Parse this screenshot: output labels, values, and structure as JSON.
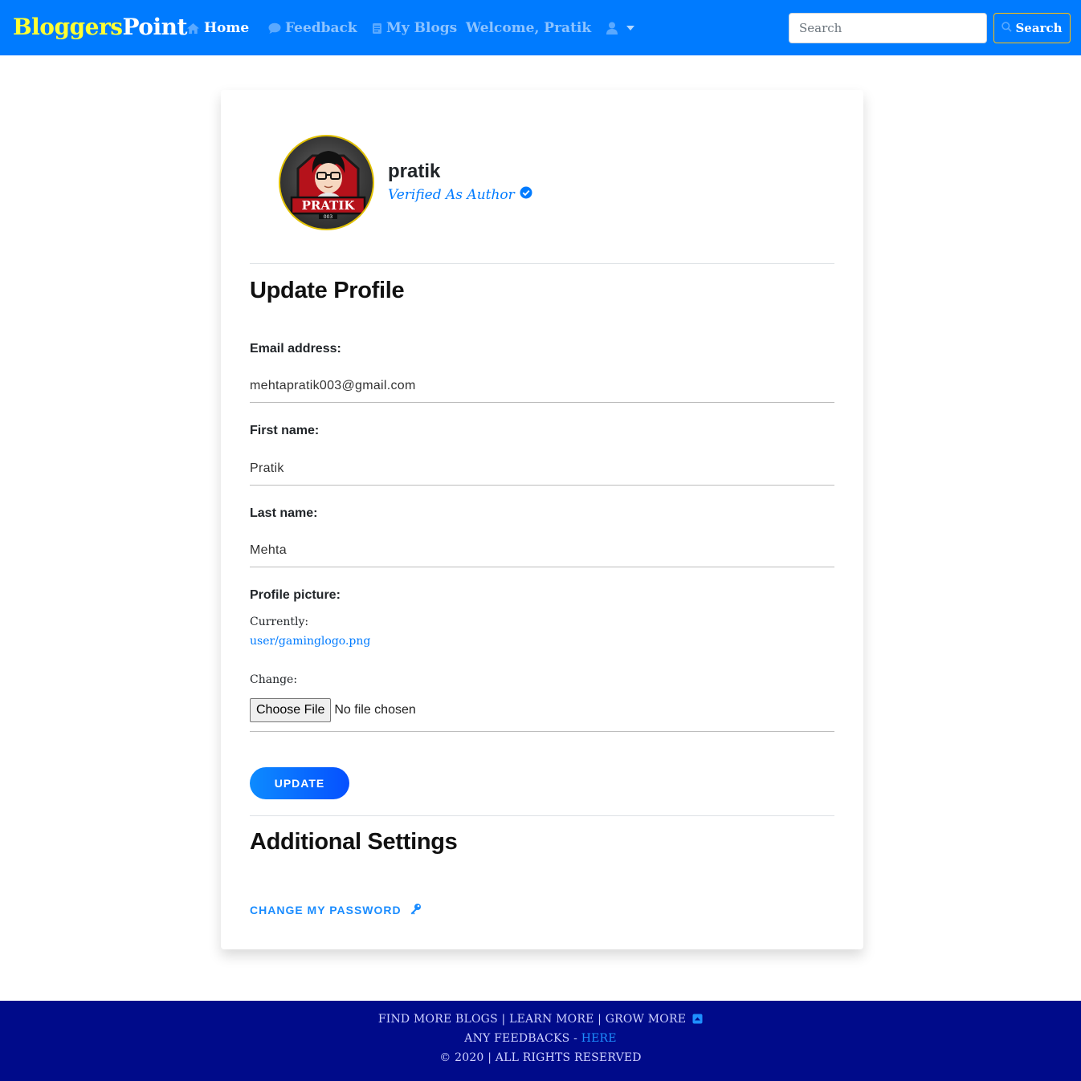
{
  "nav": {
    "brand_part1": "Bloggers",
    "brand_part2": "Point",
    "home": "Home",
    "feedback": "Feedback",
    "my_blogs": "My Blogs",
    "welcome": "Welcome, Pratik",
    "search_placeholder": "Search",
    "search_button": "Search"
  },
  "profile": {
    "avatar_text": "PRATIK",
    "avatar_subtext": "003",
    "username": "pratik",
    "verified_text": "Verified As Author"
  },
  "form": {
    "title": "Update Profile",
    "email_label": "Email address:",
    "email_value": "mehtapratik003@gmail.com",
    "first_name_label": "First name:",
    "first_name_value": "Pratik",
    "last_name_label": "Last name:",
    "last_name_value": "Mehta",
    "picture_label": "Profile picture:",
    "currently_label": "Currently:",
    "current_file": "user/gaminglogo.png",
    "change_label": "Change:",
    "choose_file": "Choose File",
    "no_file": "No file chosen",
    "update_button": "UPDATE"
  },
  "settings": {
    "title": "Additional Settings",
    "change_password": "CHANGE MY PASSWORD"
  },
  "footer": {
    "line1": "FIND MORE BLOGS | LEARN MORE | GROW MORE",
    "line2_prefix": "ANY FEEDBACKS - ",
    "line2_link": "HERE",
    "line3": "© 2020 | ALL RIGHTS RESERVED"
  },
  "colors": {
    "navbar": "#007bff",
    "brand_yellow": "#ffff33",
    "footer": "#000b8a",
    "accent": "#007bff"
  }
}
